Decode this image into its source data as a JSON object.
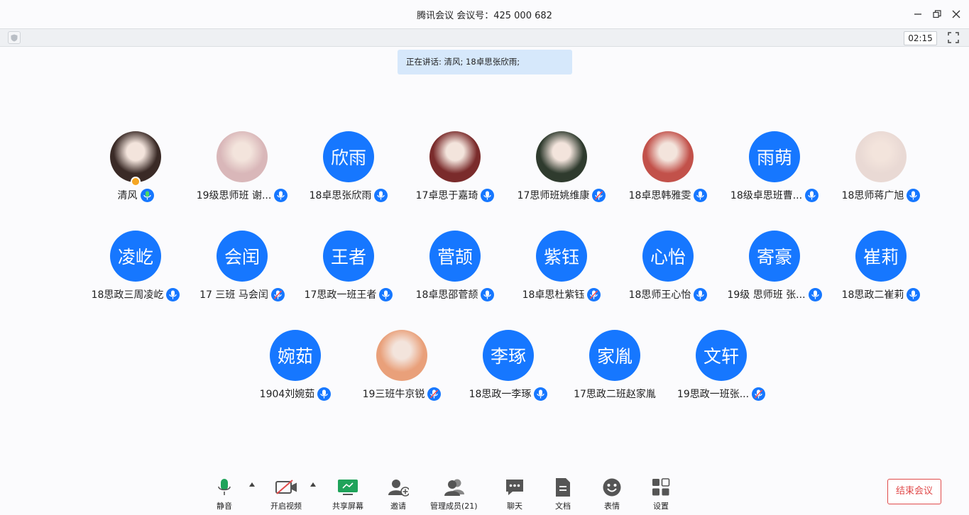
{
  "window": {
    "title": "腾讯会议 会议号：425 000 682"
  },
  "status": {
    "timer": "02:15",
    "speaking": "正在讲话: 清风; 18卓思张欣雨;"
  },
  "participants": [
    {
      "name": "清风",
      "avatar_text": "",
      "photo": true,
      "photo_color": "#3a2a26",
      "host": true,
      "mic": "speaking"
    },
    {
      "name": "19级思师班 谢...",
      "avatar_text": "",
      "photo": true,
      "photo_color": "#d9b7b9",
      "mic": "on"
    },
    {
      "name": "18卓思张欣雨",
      "avatar_text": "欣雨",
      "photo": false,
      "mic": "on"
    },
    {
      "name": "17卓思于嘉琦",
      "avatar_text": "",
      "photo": true,
      "photo_color": "#7a2b2b",
      "mic": "on"
    },
    {
      "name": "17思师班姚维康",
      "avatar_text": "",
      "photo": true,
      "photo_color": "#2f3b2e",
      "mic": "muted"
    },
    {
      "name": "18卓思韩雅雯",
      "avatar_text": "",
      "photo": true,
      "photo_color": "#c2514a",
      "mic": "on"
    },
    {
      "name": "18级卓思班曹...",
      "avatar_text": "雨萌",
      "photo": false,
      "mic": "on"
    },
    {
      "name": "18思师蒋广旭",
      "avatar_text": "",
      "photo": true,
      "photo_color": "#e9d9d4",
      "mic": "on"
    },
    {
      "name": "18思政三周凌屹",
      "avatar_text": "凌屹",
      "photo": false,
      "mic": "on"
    },
    {
      "name": "17 三班 马会闰",
      "avatar_text": "会闰",
      "photo": false,
      "mic": "muted"
    },
    {
      "name": "17思政一班王者",
      "avatar_text": "王者",
      "photo": false,
      "mic": "on"
    },
    {
      "name": "18卓思邵菅颉",
      "avatar_text": "菅颉",
      "photo": false,
      "mic": "on"
    },
    {
      "name": "18卓思杜紫钰",
      "avatar_text": "紫钰",
      "photo": false,
      "mic": "muted"
    },
    {
      "name": "18思师王心怡",
      "avatar_text": "心怡",
      "photo": false,
      "mic": "on"
    },
    {
      "name": "19级 思师班 张...",
      "avatar_text": "寄豪",
      "photo": false,
      "mic": "on"
    },
    {
      "name": "18思政二崔莉",
      "avatar_text": "崔莉",
      "photo": false,
      "mic": "on"
    },
    {
      "name": "1904刘婉茹",
      "avatar_text": "婉茹",
      "photo": false,
      "mic": "on"
    },
    {
      "name": "19三班牛京锐",
      "avatar_text": "",
      "photo": true,
      "photo_color": "#e9a07a",
      "mic": "muted"
    },
    {
      "name": "18思政一李琢",
      "avatar_text": "李琢",
      "photo": false,
      "mic": "on"
    },
    {
      "name": "17思政二班赵家胤",
      "avatar_text": "家胤",
      "photo": false,
      "mic": "none"
    },
    {
      "name": "19思政一班张...",
      "avatar_text": "文轩",
      "photo": false,
      "mic": "muted"
    }
  ],
  "toolbar": {
    "mute": "静音",
    "video": "开启视频",
    "share": "共享屏幕",
    "invite": "邀请",
    "members": "管理成员(21)",
    "chat": "聊天",
    "docs": "文档",
    "emoji": "表情",
    "settings": "设置",
    "end": "结束会议"
  },
  "colors": {
    "accent": "#1677ff",
    "end": "#e04a4a",
    "share_green": "#1fa35a"
  }
}
